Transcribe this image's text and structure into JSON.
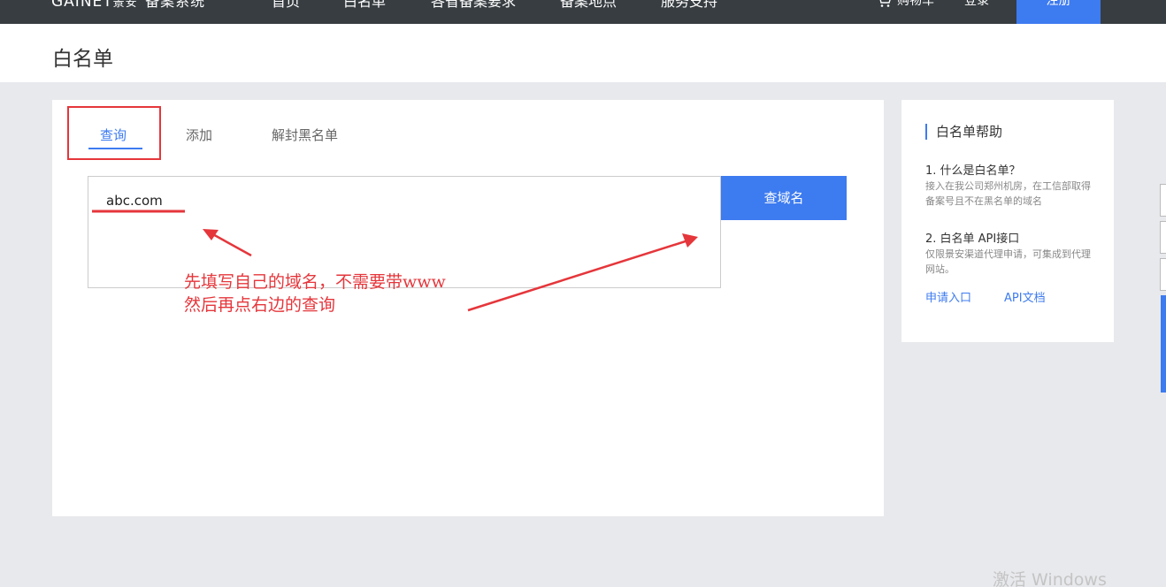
{
  "topbar": {
    "logo": "GAINET",
    "logo_cn": "景安",
    "logo_system": "备案系统",
    "nav": [
      "首页",
      "白名单",
      "各省备案要求",
      "备案地点",
      "服务支持"
    ],
    "cart": "购物车",
    "login": "登录",
    "register": "注册"
  },
  "page": {
    "title": "白名单"
  },
  "tabs": [
    "查询",
    "添加",
    "解封黑名单"
  ],
  "search": {
    "value": "abc.com",
    "button": "查域名"
  },
  "annotation": {
    "line1": "先填写自己的域名，不需要带www",
    "line2": "然后再点右边的查询"
  },
  "help": {
    "title": "白名单帮助",
    "items": [
      {
        "q": "1. 什么是白名单？",
        "a": "接入在我公司郑州机房，在工信部取得备案号且不在黑名单的域名"
      },
      {
        "q": "2. 白名单 API接口",
        "a": "仅限景安渠道代理申请，可集成到代理网站。"
      }
    ],
    "links": [
      "申请入口",
      "API文档"
    ]
  },
  "watermark": "激活 Windows",
  "colors": {
    "accent": "#3d7bf0",
    "annotation": "#e5363b",
    "topbar": "#373d41"
  }
}
